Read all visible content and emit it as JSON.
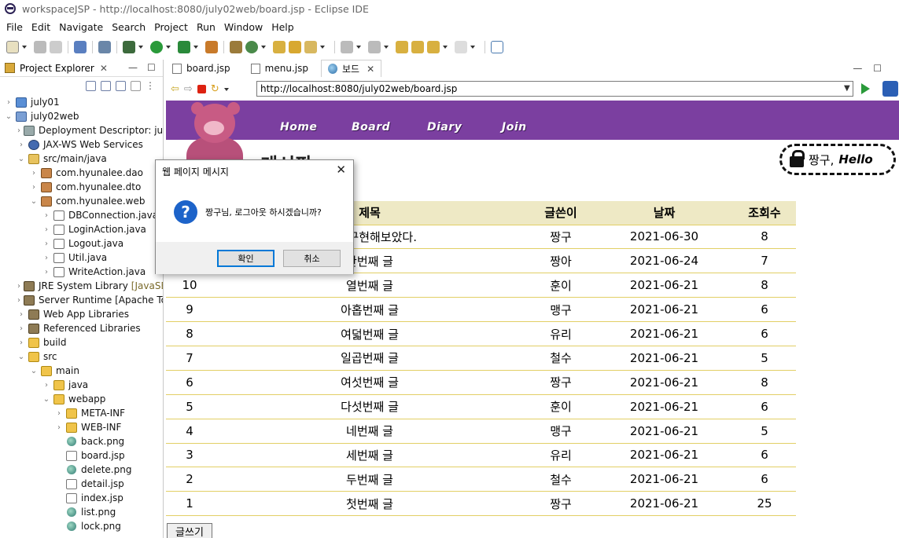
{
  "window": {
    "title": "workspaceJSP - http://localhost:8080/july02web/board.jsp - Eclipse IDE"
  },
  "menu": [
    "File",
    "Edit",
    "Navigate",
    "Search",
    "Project",
    "Run",
    "Window",
    "Help"
  ],
  "project_explorer": {
    "title": "Project Explorer",
    "tree": [
      {
        "label": "july01",
        "indent": 0,
        "icon": "proj"
      },
      {
        "label": "july02web",
        "indent": 0,
        "icon": "web"
      },
      {
        "label": "Deployment Descriptor: july",
        "indent": 1,
        "icon": "desc"
      },
      {
        "label": "JAX-WS Web Services",
        "indent": 1,
        "icon": "ws"
      },
      {
        "label": "src/main/java",
        "indent": 1,
        "icon": "srcf"
      },
      {
        "label": "com.hyunalee.dao",
        "indent": 2,
        "icon": "pkg"
      },
      {
        "label": "com.hyunalee.dto",
        "indent": 2,
        "icon": "pkg"
      },
      {
        "label": "com.hyunalee.web",
        "indent": 2,
        "icon": "pkg"
      },
      {
        "label": "DBConnection.java",
        "indent": 3,
        "icon": "java"
      },
      {
        "label": "LoginAction.java",
        "indent": 3,
        "icon": "java"
      },
      {
        "label": "Logout.java",
        "indent": 3,
        "icon": "java"
      },
      {
        "label": "Util.java",
        "indent": 3,
        "icon": "java"
      },
      {
        "label": "WriteAction.java",
        "indent": 3,
        "icon": "java"
      },
      {
        "label": "JRE System Library",
        "suffix": "[JavaSE-",
        "indent": 1,
        "icon": "lib"
      },
      {
        "label": "Server Runtime [Apache To",
        "indent": 1,
        "icon": "lib"
      },
      {
        "label": "Web App Libraries",
        "indent": 1,
        "icon": "lib"
      },
      {
        "label": "Referenced Libraries",
        "indent": 1,
        "icon": "lib"
      },
      {
        "label": "build",
        "indent": 1,
        "icon": "folder"
      },
      {
        "label": "src",
        "indent": 1,
        "icon": "folder"
      },
      {
        "label": "main",
        "indent": 2,
        "icon": "folder"
      },
      {
        "label": "java",
        "indent": 3,
        "icon": "folder"
      },
      {
        "label": "webapp",
        "indent": 3,
        "icon": "folder"
      },
      {
        "label": "META-INF",
        "indent": 4,
        "icon": "folder"
      },
      {
        "label": "WEB-INF",
        "indent": 4,
        "icon": "folder"
      },
      {
        "label": "back.png",
        "indent": 4,
        "icon": "png"
      },
      {
        "label": "board.jsp",
        "indent": 4,
        "icon": "jsp"
      },
      {
        "label": "delete.png",
        "indent": 4,
        "icon": "png"
      },
      {
        "label": "detail.jsp",
        "indent": 4,
        "icon": "jsp"
      },
      {
        "label": "index.jsp",
        "indent": 4,
        "icon": "jsp"
      },
      {
        "label": "list.png",
        "indent": 4,
        "icon": "png"
      },
      {
        "label": "lock.png",
        "indent": 4,
        "icon": "png"
      }
    ]
  },
  "editor_tabs": [
    {
      "label": "board.jsp",
      "active": false
    },
    {
      "label": "menu.jsp",
      "active": false
    },
    {
      "label": "보드",
      "active": true
    }
  ],
  "browser": {
    "url": "http://localhost:8080/july02web/board.jsp"
  },
  "site": {
    "nav": [
      "Home",
      "Board",
      "Diary",
      "Join"
    ],
    "heading": "게시판",
    "user_name": "짱구,",
    "user_greeting": "Hello",
    "write_button": "글쓰기"
  },
  "board": {
    "headers": [
      "번호",
      "제목",
      "글쓴이",
      "날짜",
      "조회수"
    ],
    "rows": [
      {
        "num": "",
        "title": "까지 구현해보았다.",
        "writer": "짱구",
        "date": "2021-06-30",
        "count": "8"
      },
      {
        "num": "",
        "title": "한번째 글",
        "writer": "짱아",
        "date": "2021-06-24",
        "count": "7"
      },
      {
        "num": "10",
        "title": "열번째 글",
        "writer": "훈이",
        "date": "2021-06-21",
        "count": "8"
      },
      {
        "num": "9",
        "title": "아홉번째 글",
        "writer": "맹구",
        "date": "2021-06-21",
        "count": "6"
      },
      {
        "num": "8",
        "title": "여덟번째 글",
        "writer": "유리",
        "date": "2021-06-21",
        "count": "6"
      },
      {
        "num": "7",
        "title": "일곱번째 글",
        "writer": "철수",
        "date": "2021-06-21",
        "count": "5"
      },
      {
        "num": "6",
        "title": "여섯번째 글",
        "writer": "짱구",
        "date": "2021-06-21",
        "count": "8"
      },
      {
        "num": "5",
        "title": "다섯번째 글",
        "writer": "훈이",
        "date": "2021-06-21",
        "count": "6"
      },
      {
        "num": "4",
        "title": "네번째 글",
        "writer": "맹구",
        "date": "2021-06-21",
        "count": "5"
      },
      {
        "num": "3",
        "title": "세번째 글",
        "writer": "유리",
        "date": "2021-06-21",
        "count": "6"
      },
      {
        "num": "2",
        "title": "두번째 글",
        "writer": "철수",
        "date": "2021-06-21",
        "count": "6"
      },
      {
        "num": "1",
        "title": "첫번째 글",
        "writer": "짱구",
        "date": "2021-06-21",
        "count": "25"
      }
    ]
  },
  "dialog": {
    "title": "웹 페이지 메시지",
    "message": "짱구님, 로그아웃 하시겠습니까?",
    "ok_label": "확인",
    "cancel_label": "취소"
  },
  "colors": {
    "nav_bg": "#7b3fa0",
    "table_header_bg": "#eee9c5",
    "table_border": "#e2cf65",
    "dialog_icon": "#1d63c9"
  }
}
